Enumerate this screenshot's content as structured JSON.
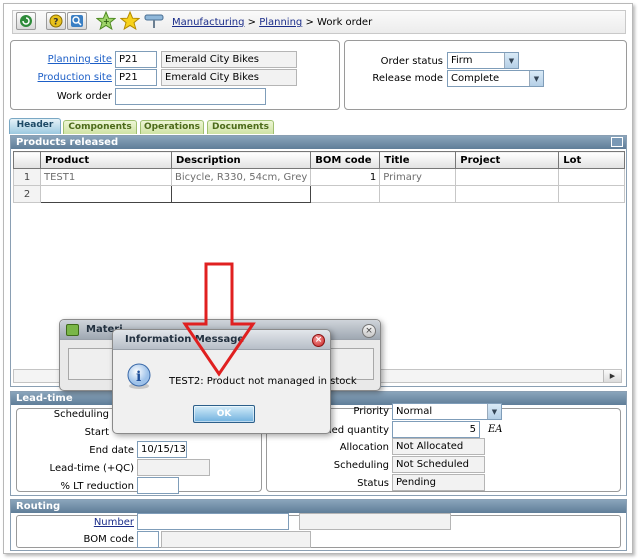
{
  "breadcrumb": {
    "part1": "Manufacturing",
    "sep1": ">",
    "part2": "Planning",
    "sep2": ">",
    "current": "Work order"
  },
  "header": {
    "planning_site_label": "Planning site",
    "planning_site_code": "P21",
    "planning_site_name": "Emerald City Bikes",
    "production_site_label": "Production site",
    "production_site_code": "P21",
    "production_site_name": "Emerald City Bikes",
    "work_order_label": "Work order",
    "work_order_value": "",
    "order_status_label": "Order status",
    "order_status_value": "Firm",
    "release_mode_label": "Release mode",
    "release_mode_value": "Complete"
  },
  "tabs": [
    "Header",
    "Components",
    "Operations",
    "Documents"
  ],
  "products": {
    "title": "Products released",
    "columns": [
      "Product",
      "Description",
      "BOM code",
      "Title",
      "Project",
      "Lot"
    ],
    "rows": [
      {
        "num": "1",
        "product": "TEST1",
        "description": "Bicycle, R330, 54cm, Grey",
        "bom": "1",
        "title": "Primary",
        "project": "",
        "lot": ""
      },
      {
        "num": "2",
        "product": "",
        "description": "",
        "bom": "",
        "title": "",
        "project": "",
        "lot": ""
      }
    ]
  },
  "leadtime": {
    "title": "Lead-time",
    "scheduling_label": "Scheduling",
    "start_label": "Start",
    "end_date_label": "End date",
    "end_date_value": "10/15/13",
    "leadtime_qc_label": "Lead-time (+QC)",
    "lt_reduction_label": "% LT reduction",
    "priority_label": "Priority",
    "priority_value": "Normal",
    "planned_quantity_label": "nned quantity",
    "planned_quantity_value": "5",
    "planned_quantity_unit": "EA",
    "allocation_label": "Allocation",
    "allocation_value": "Not Allocated",
    "scheduling_status_label": "Scheduling",
    "scheduling_status_value": "Not Scheduled",
    "status_label": "Status",
    "status_value": "Pending"
  },
  "routing": {
    "title": "Routing",
    "number_label": "Number",
    "bom_code_label": "BOM code"
  },
  "materials_dialog": {
    "title": "Materi"
  },
  "info_dialog": {
    "title": "Information Message",
    "message": "TEST2: Product not managed in stock",
    "ok_label": "OK",
    "icon": "info-icon"
  },
  "colors": {
    "annotation_arrow": "#e02020",
    "section_header": "#6f8aa4",
    "link": "#1d5fc7"
  }
}
